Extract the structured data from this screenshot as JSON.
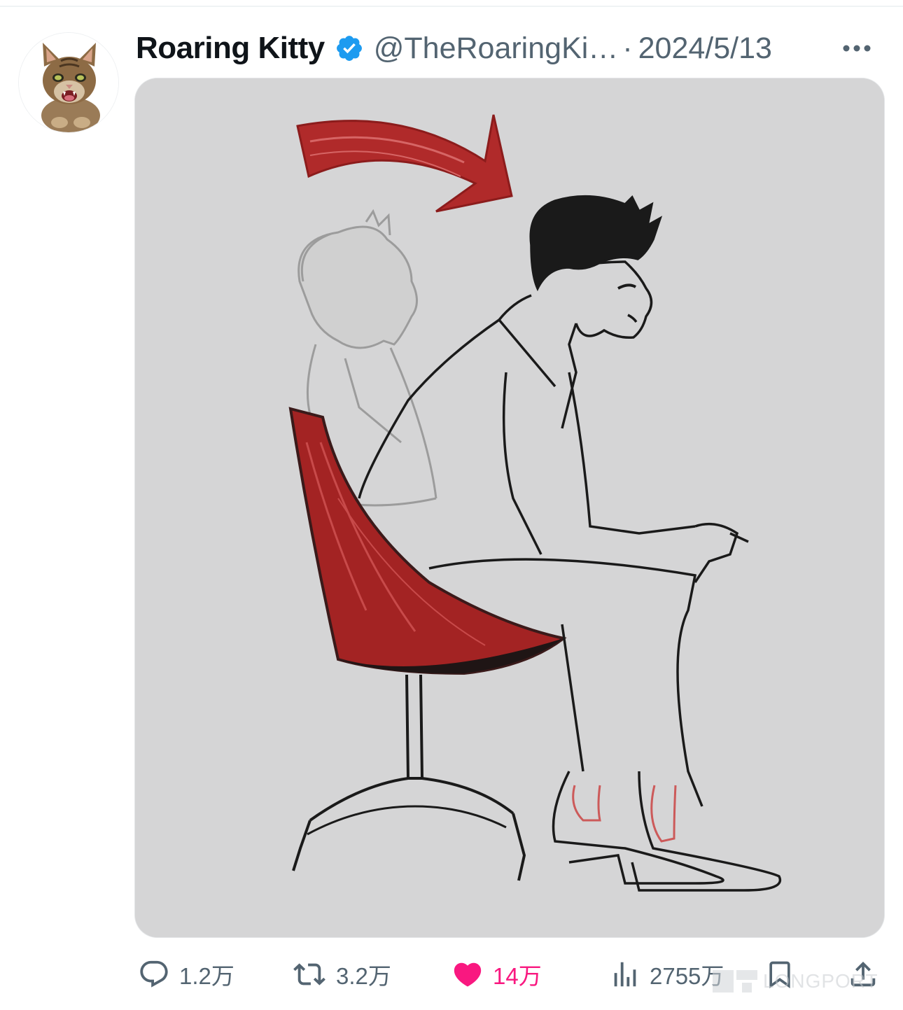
{
  "tweet": {
    "display_name": "Roaring Kitty",
    "verified_icon": "verified-badge-icon",
    "handle": "@TheRoaringKi…",
    "separator": "·",
    "timestamp": "2024/5/13",
    "more_icon": "more-horizontal-icon",
    "avatar_icon": "kitten-avatar",
    "media_description_icon": "cartoon-man-leaning-forward-in-chair"
  },
  "actions": {
    "reply": {
      "icon": "reply-bubble-icon",
      "count": "1.2万"
    },
    "retweet": {
      "icon": "retweet-icon",
      "count": "3.2万"
    },
    "like": {
      "icon": "heart-icon",
      "count": "14万",
      "liked": true
    },
    "views": {
      "icon": "views-chart-icon",
      "count": "2755万"
    },
    "bookmark": {
      "icon": "bookmark-icon"
    },
    "share": {
      "icon": "share-upload-icon"
    }
  },
  "watermark": {
    "text": "LONGPORT"
  },
  "colors": {
    "text_primary": "#0f1419",
    "text_secondary": "#536471",
    "verified_blue": "#1d9bf0",
    "like_pink": "#f91880",
    "media_bg": "#d5d5d6",
    "chair_red": "#a32323"
  }
}
